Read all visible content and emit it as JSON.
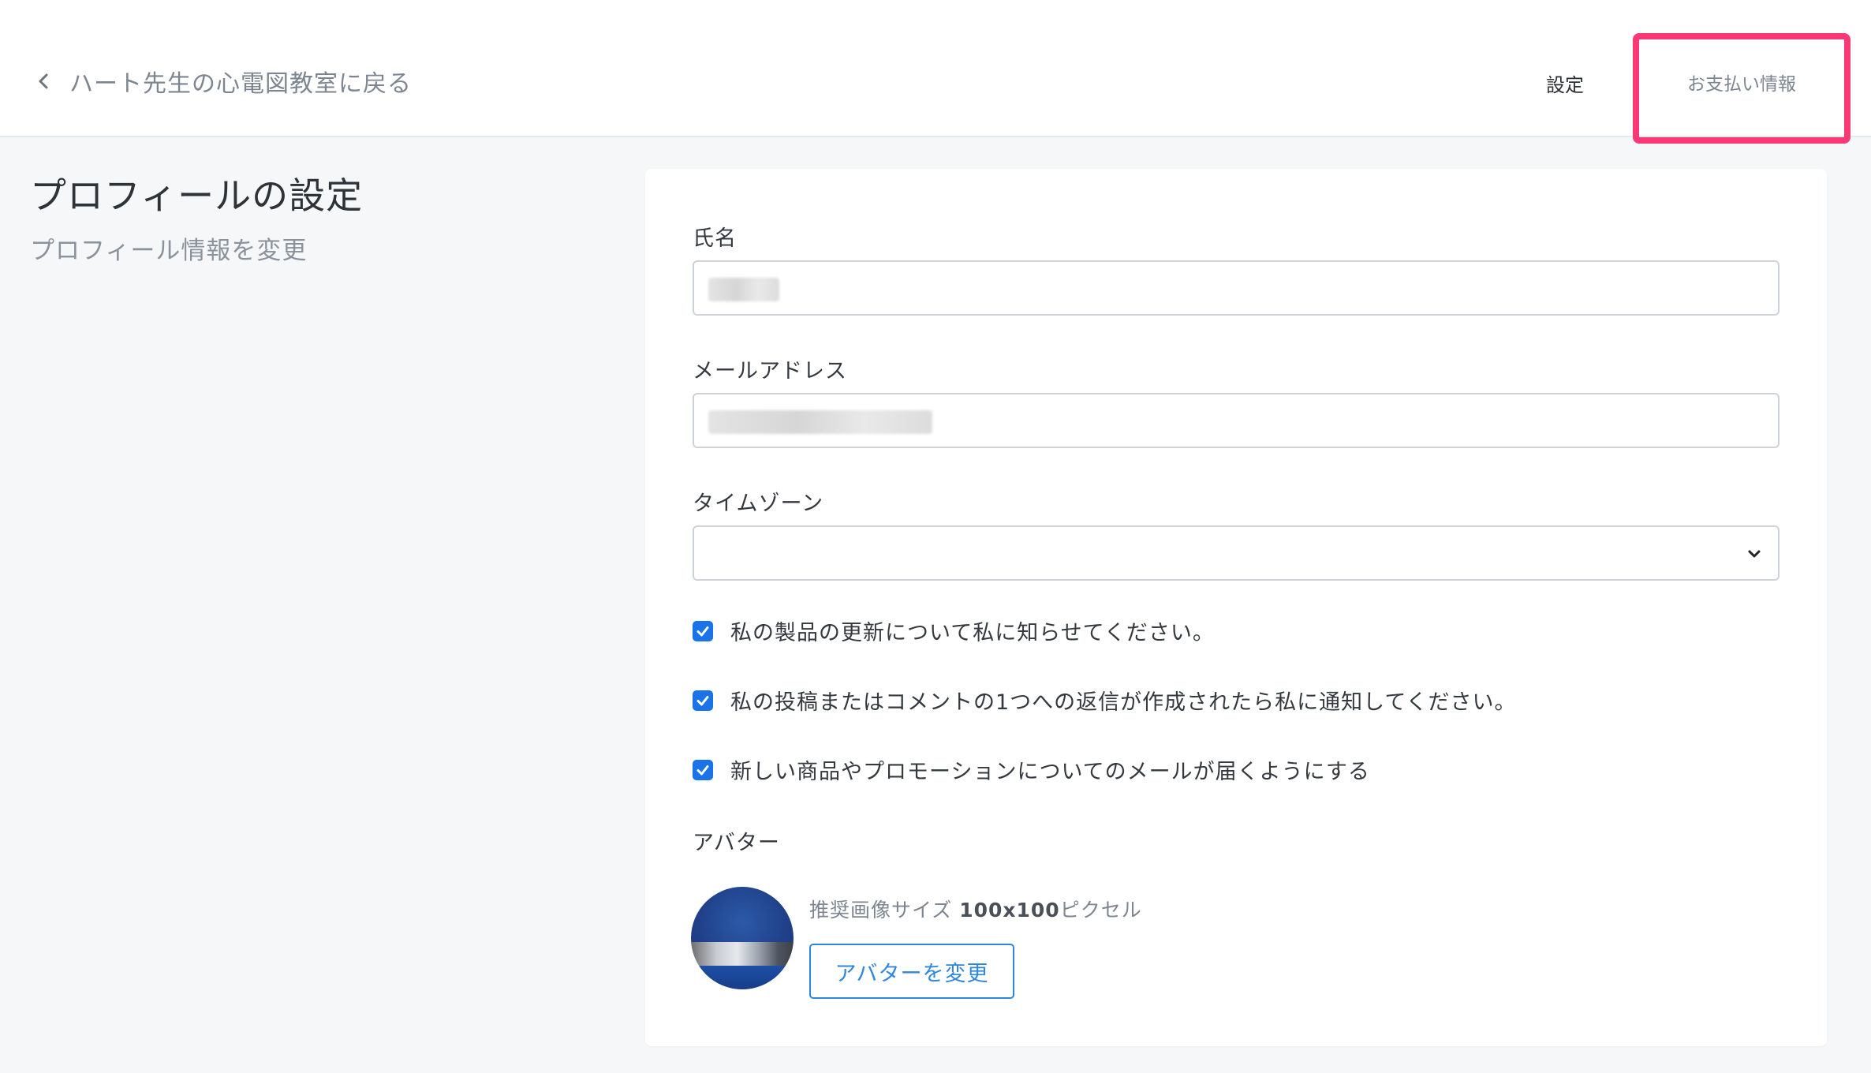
{
  "header": {
    "back_label": "ハート先生の心電図教室に戻る",
    "nav_settings": "設定",
    "nav_billing": "お支払い情報"
  },
  "page": {
    "title": "プロフィールの設定",
    "subtitle": "プロフィール情報を変更"
  },
  "form": {
    "name_label": "氏名",
    "name_value": "",
    "email_label": "メールアドレス",
    "email_value": "",
    "timezone_label": "タイムゾーン",
    "timezone_value": "",
    "checkboxes": [
      {
        "label": "私の製品の更新について私に知らせてください。",
        "checked": true
      },
      {
        "label": "私の投稿またはコメントの1つへの返信が作成されたら私に通知してください。",
        "checked": true
      },
      {
        "label": "新しい商品やプロモーションについてのメールが届くようにする",
        "checked": true
      }
    ],
    "avatar_label": "アバター",
    "avatar_hint_prefix": "推奨画像サイズ ",
    "avatar_hint_size": "100x100",
    "avatar_hint_suffix": "ピクセル",
    "change_avatar_label": "アバターを変更"
  },
  "colors": {
    "highlight_border": "#f93876",
    "accent": "#2f86dd",
    "checkbox": "#1a73e8"
  },
  "icons": {
    "back": "chevron-left-icon",
    "select": "chevron-down-icon",
    "check": "checkmark-icon"
  }
}
